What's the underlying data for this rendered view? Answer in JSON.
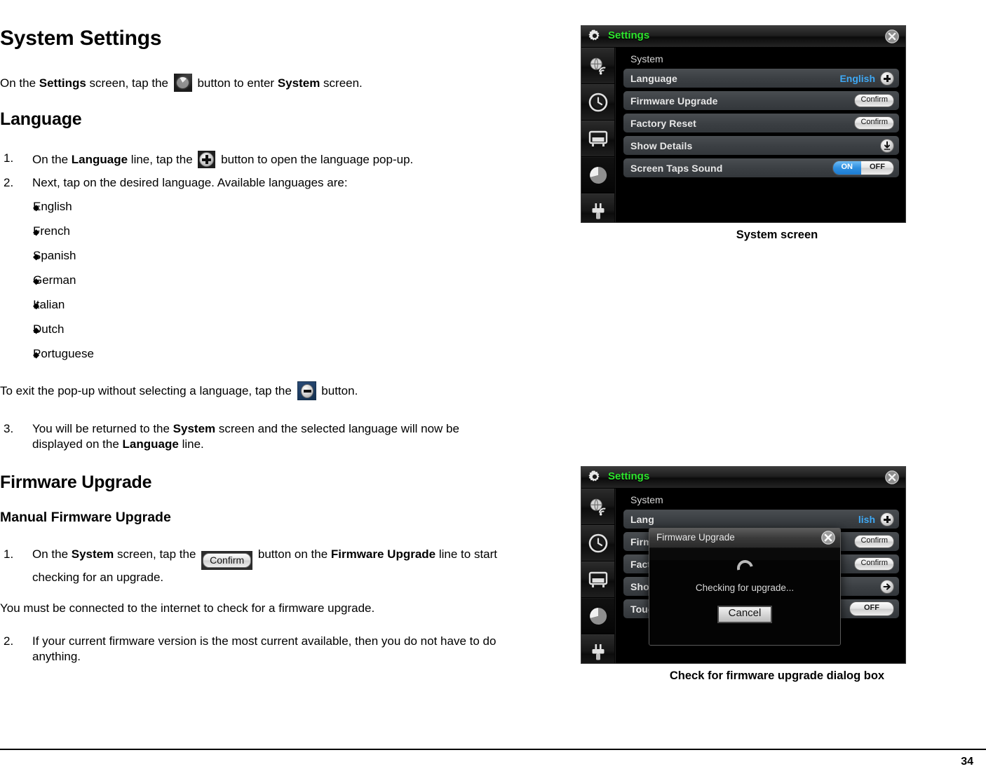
{
  "document": {
    "page_number": "34",
    "h1": "System Settings",
    "intro": {
      "part1": "On the ",
      "bold1": "Settings",
      "part2": " screen, tap the ",
      "icon": "pie-chart-icon",
      "part3": " button to enter ",
      "bold2": "System",
      "part4": " screen."
    },
    "language_heading": "Language",
    "language_steps": [
      {
        "number": "1.",
        "part1": "On the ",
        "bold1": "Language",
        "part2": " line, tap the ",
        "icon": "plus-button-icon",
        "part3": " button to open the language pop-up."
      },
      {
        "number": "2.",
        "text": "Next, tap on the desired language.  Available languages are:"
      }
    ],
    "languages": [
      "English",
      "French",
      "Spanish",
      "German",
      "Italian",
      "Dutch",
      "Portuguese"
    ],
    "exit_popup": {
      "part1": "To exit the pop-up without selecting a language, tap the ",
      "icon": "minus-button-icon",
      "part2": " button."
    },
    "language_step3": {
      "number": "3.",
      "part1": "You will be returned to the ",
      "bold1": "System",
      "part2": " screen and the selected language will now be displayed on the ",
      "bold2": "Language",
      "part3": " line."
    },
    "firmware_heading": "Firmware Upgrade",
    "manual_firmware_heading": "Manual Firmware Upgrade",
    "firmware_step1": {
      "number": "1.",
      "part1": "On the ",
      "bold1": "System",
      "part2": " screen, tap the ",
      "button_label": "Confirm",
      "part3": " button on the ",
      "bold2": "Firmware Upgrade",
      "part4": " line to start checking for an upgrade."
    },
    "firmware_note": "You must be connected to the internet to check for a firmware upgrade.",
    "firmware_step2": {
      "number": "2.",
      "text": "If your current firmware version is the most current available, then you do not have to do anything."
    },
    "bullet_glyph": "◆"
  },
  "figure1": {
    "caption": "System screen",
    "titlebar": {
      "gear_icon": "gear-icon",
      "title": "Settings",
      "close_icon": "close-icon"
    },
    "rail": [
      {
        "icon": "network-globe-wifi-icon",
        "selected": false
      },
      {
        "icon": "clock-icon",
        "selected": false
      },
      {
        "icon": "display-monitor-icon",
        "selected": false
      },
      {
        "icon": "pie-chart-icon",
        "selected": true
      },
      {
        "icon": "power-plug-icon",
        "selected": false
      }
    ],
    "section_label": "System",
    "rows": [
      {
        "label": "Language",
        "value": "English",
        "control": "plus-round-button"
      },
      {
        "label": "Firmware Upgrade",
        "control": "pill-button",
        "button_label": "Confirm"
      },
      {
        "label": "Factory Reset",
        "control": "pill-button",
        "button_label": "Confirm"
      },
      {
        "label": "Show Details",
        "control": "download-round-button"
      },
      {
        "label": "Screen Taps Sound",
        "control": "on-off-toggle",
        "on_label": "ON",
        "off_label": "OFF",
        "state": "ON"
      }
    ],
    "accent_blue": "#3fa9f5",
    "title_green": "#2ee62e"
  },
  "figure2": {
    "caption": "Check for firmware upgrade dialog box",
    "titlebar": {
      "gear_icon": "gear-icon",
      "title": "Settings",
      "close_icon": "close-icon"
    },
    "rail": [
      {
        "icon": "network-globe-wifi-icon",
        "selected": false
      },
      {
        "icon": "clock-icon",
        "selected": false
      },
      {
        "icon": "display-monitor-icon",
        "selected": false
      },
      {
        "icon": "pie-chart-icon",
        "selected": true
      },
      {
        "icon": "power-plug-icon",
        "selected": false
      }
    ],
    "section_label": "System",
    "rows": [
      {
        "label": "Lang",
        "value": "lish",
        "control": "plus-round-button"
      },
      {
        "label": "Firm",
        "control": "pill-button",
        "button_label": "Confirm"
      },
      {
        "label": "Fact",
        "control": "pill-button",
        "button_label": "Confirm"
      },
      {
        "label": "Show",
        "control": "arrow-round-button"
      },
      {
        "label": "Touc",
        "control": "off-toggle",
        "off_label": "OFF"
      }
    ],
    "dialog": {
      "title": "Firmware Upgrade",
      "close_icon": "close-icon",
      "spinner": "loading-spinner",
      "message": "Checking for upgrade...",
      "cancel_label": "Cancel"
    }
  }
}
